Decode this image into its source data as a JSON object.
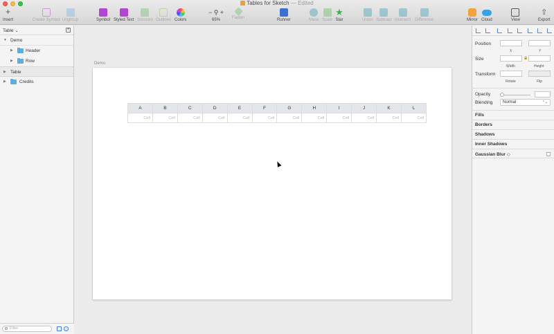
{
  "window": {
    "title": "Tables for Sketch",
    "status": "— Edited"
  },
  "toolbar": {
    "insert": "Insert",
    "create_symbol": "Create Symbol",
    "ungroup": "Ungroup",
    "symbol": "Symbol",
    "styled_text": "Styled Text",
    "scissors": "Scissors",
    "outlines": "Outlines",
    "colors": "Colors",
    "zoom_minus": "−",
    "zoom_plus": "+",
    "zoom_level": "65%",
    "flatten": "Flatten",
    "runner": "Runner",
    "mask": "Mask",
    "scale": "Scale",
    "star": "Star",
    "union": "Union",
    "subtract": "Subtract",
    "intersect": "Intersect",
    "difference": "Difference",
    "mirror": "Mirror",
    "cloud": "Cloud",
    "view": "View",
    "export": "Export",
    "colors_accent": {
      "symbol": "#b345d6",
      "styled_text": "#b345d6",
      "runner": "#3b6fd1",
      "star": "#3bb34a",
      "mask": "#7fb8c8",
      "mirror": "#f3a23a",
      "cloud": "#3ca0e8"
    }
  },
  "layers": {
    "page_selector": "Table ⌄",
    "items": [
      {
        "label": "Demo",
        "arrow": "▼"
      },
      {
        "label": "Header",
        "arrow": "▶"
      },
      {
        "label": "Row",
        "arrow": "▶"
      },
      {
        "label": "Table",
        "arrow": "▶"
      },
      {
        "label": "Credits",
        "arrow": "▶"
      }
    ],
    "filter_placeholder": "Filter"
  },
  "canvas": {
    "artboard_label": "Demo",
    "table": {
      "headers": [
        "A",
        "B",
        "C",
        "D",
        "E",
        "F",
        "G",
        "H",
        "I",
        "J",
        "K",
        "L"
      ],
      "cells": [
        "Cell",
        "Cell",
        "Cell",
        "Cell",
        "Cell",
        "Cell",
        "Cell",
        "Cell",
        "Cell",
        "Cell",
        "Cell",
        "Cell"
      ]
    }
  },
  "inspector": {
    "position": "Position",
    "x": "X",
    "y": "Y",
    "size": "Size",
    "width": "Width",
    "height": "Height",
    "transform": "Transform",
    "rotate": "Rotate",
    "flip": "Flip",
    "opacity": "Opacity",
    "blending": "Blending",
    "blending_value": "Normal",
    "sections": [
      "Fills",
      "Borders",
      "Shadows",
      "Inner Shadows",
      "Gaussian Blur ◇"
    ]
  }
}
